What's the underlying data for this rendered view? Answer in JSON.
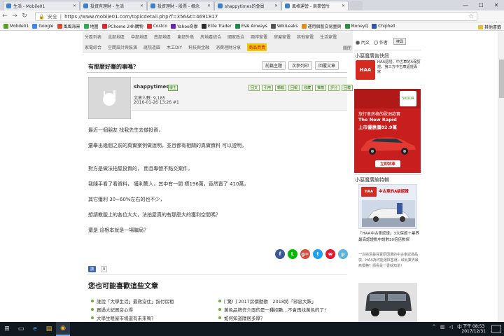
{
  "browser": {
    "tabs": [
      {
        "label": "生活 - Mobile01",
        "color": "#3c7fd1",
        "active": false
      },
      {
        "label": "投資有理財 - 生活",
        "color": "#3c7fd1",
        "active": false
      },
      {
        "label": "投資理財 - 股票 - 概念",
        "color": "#3c7fd1",
        "active": false
      },
      {
        "label": "shappytimes的會員",
        "color": "#3c7fd1",
        "active": false
      },
      {
        "label": "風格運營 - 商業營所",
        "color": "#3c7fd1",
        "active": true
      }
    ],
    "address": {
      "secure_label": "安全",
      "url": "https://www.mobile01.com/topicdetail.php?f=356&t=4691817"
    },
    "bookmarks": [
      {
        "label": "Mobile01",
        "color": "#5aa02c"
      },
      {
        "label": "Google",
        "color": "#4285f4"
      },
      {
        "label": "風風海景",
        "color": "#d94b2b"
      },
      {
        "label": "地圖",
        "color": "#34a853"
      },
      {
        "label": "PChome 24h購物",
        "color": "#d62b2b"
      },
      {
        "label": "Costco",
        "color": "#e0302c"
      },
      {
        "label": "Yahoo奇摩",
        "color": "#6d27b3"
      },
      {
        "label": "Elite Trader",
        "color": "#2b2b2b"
      },
      {
        "label": "EVA Airways",
        "color": "#1f8c4e"
      },
      {
        "label": "WikiLeaks",
        "color": "#555555"
      },
      {
        "label": "運用個股交易量與",
        "color": "#e08d1c"
      },
      {
        "label": "MoneyQ",
        "color": "#2f8f3f"
      },
      {
        "label": "Chiphell",
        "color": "#3355aa"
      }
    ],
    "bookmarks_other": "其他書籤"
  },
  "catnav": {
    "row1": [
      "分區列表",
      "北部地區",
      "中部地區",
      "南部地區",
      "東部外島",
      "房地產綜合",
      "國家政治",
      "兩岸家電",
      "房屋家電",
      "其他家電",
      "生活家電"
    ],
    "row2": [
      "家電綜合",
      "空間設計與裝潢",
      "庭院造園",
      "木工DIY",
      "科技與金融",
      "消費理財分享",
      "商品買賣"
    ],
    "highlight": "商品買賣",
    "right": "關閉"
  },
  "post": {
    "title": "有那麼好賺的事嗎？",
    "actions": [
      "前篇主題",
      "次參列印",
      "回覆文章"
    ],
    "user": {
      "name": "shappytimes",
      "level": "樓主",
      "stats": "文章人數: 9,185",
      "datetime": "2016-01-26 13:26  #1"
    },
    "tools": [
      "回文",
      "引用",
      "轉載",
      "回報",
      "收藏",
      "推薦",
      "評分",
      "回覆"
    ],
    "paragraphs": [
      "最近一個朋友 找我先生去做投資，",
      "還舉出幾個之前的真實案例做說明，並且都有相關的真實資料 可以證明，",
      "對方是做法拍屋投資的， 而且專營不點交案件，",
      "我隨手看了看資料， 獲利驚人，其中有一間 標196萬，竟然賣了 410萬，",
      "其它獲利 30~60%左右的也不少，",
      "想請教版上的各位大大，法拍屋真的有那麼大的獲利空間嗎？",
      "還是 這根本就是一場騙局？"
    ],
    "share_icons": [
      {
        "name": "facebook-share-icon",
        "glyph": "f",
        "color": "#3b5998"
      },
      {
        "name": "line-share-icon",
        "glyph": "L",
        "color": "#00b900"
      },
      {
        "name": "googleplus-share-icon",
        "glyph": "g+",
        "color": "#dd4b39"
      },
      {
        "name": "twitter-share-icon",
        "glyph": "t",
        "color": "#1da1f2"
      },
      {
        "name": "weibo-share-icon",
        "glyph": "w",
        "color": "#e6162d"
      },
      {
        "name": "plurk-share-icon",
        "glyph": "p",
        "color": "#58b5e1"
      }
    ],
    "like": {
      "label": "讚",
      "count": "0"
    }
  },
  "related": {
    "title": "您也可能喜歡這些文章",
    "left": [
      "誰說「大學生活」最救沒住」指付房租",
      "買過大紀買房心得",
      "大學生租屋市場還有未來嗎？"
    ],
    "right": [
      "[ 驚! ] 2017房價動動　2018將「邪惡大跌」",
      "黃色品牌作介面的是一種招數…不會再找黃色的了!",
      "如何知道隱居多厚？"
    ]
  },
  "sidebar": {
    "search_options": [
      {
        "label": "內文",
        "checked": true
      },
      {
        "label": "作者",
        "checked": false
      }
    ],
    "search_button": "搜尋",
    "news_title": "小惡魔廣告快訊",
    "haa_logo": "HAA",
    "haa_text": "HAA認證，中古車的A保認證，第三方中古車認證專家",
    "skoda": {
      "logo": "SKODA",
      "line1": "旅行車房格的歐洲款實",
      "line2": "The New Rapid",
      "line3": "上市優惠價82.9萬",
      "button": "立即試車"
    },
    "specials_title": "小惡魔廣編特輯",
    "specials_logo": "HAA",
    "specials_head": "中古車的A級認證",
    "specials_link": "「HAA中古車認證」3大保證＋業界最高認證數中請數30倍倍數保",
    "specials_desc": "一次搞清楚買賣原因選的中古車認證品檢，HAA為何能選擇答選，城北業界最高價格？請看是一書就知道！"
  },
  "taskbar": {
    "time": "下午 08:53",
    "date": "2017/12/31",
    "ime": "中"
  }
}
